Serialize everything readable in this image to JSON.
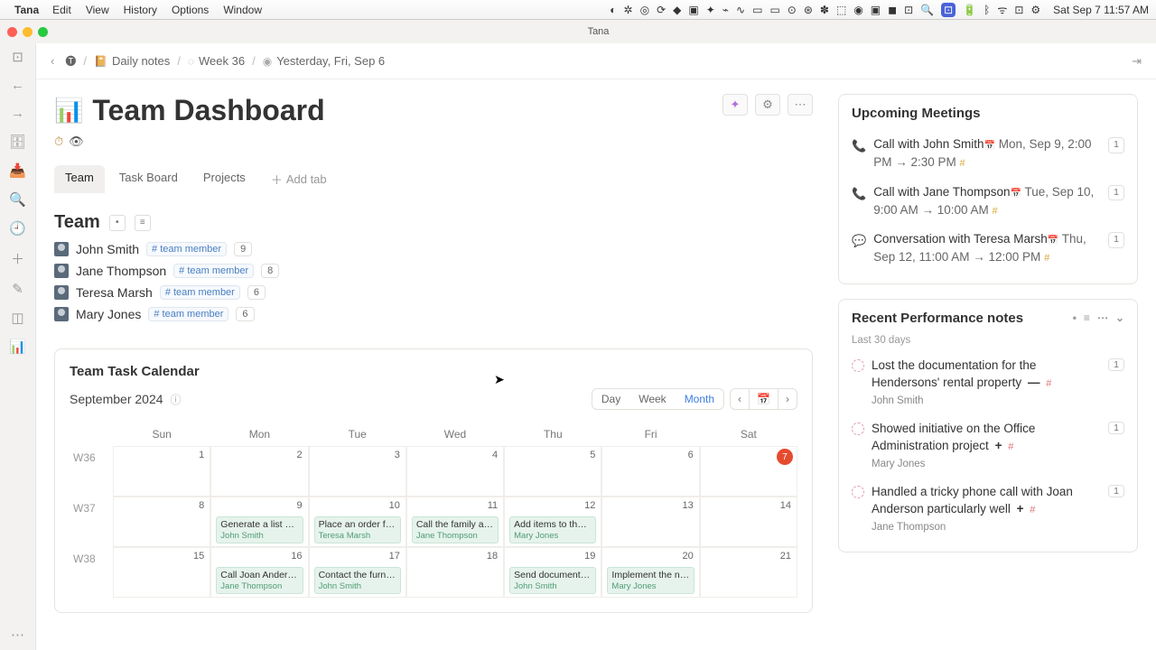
{
  "menubar": {
    "app": "Tana",
    "items": [
      "Edit",
      "View",
      "History",
      "Options",
      "Window"
    ],
    "clock": "Sat Sep 7  11:57 AM"
  },
  "window_title": "Tana",
  "breadcrumbs": {
    "items": [
      "Daily notes",
      "Week 36",
      "Yesterday, Fri, Sep 6"
    ]
  },
  "page": {
    "title": "Team Dashboard",
    "tabs": [
      "Team",
      "Task Board",
      "Projects"
    ],
    "add_tab": "Add tab"
  },
  "team": {
    "heading": "Team",
    "tag_label": "# team member",
    "members": [
      {
        "name": "John Smith",
        "count": "9"
      },
      {
        "name": "Jane Thompson",
        "count": "8"
      },
      {
        "name": "Teresa Marsh",
        "count": "6"
      },
      {
        "name": "Mary Jones",
        "count": "6"
      }
    ]
  },
  "calendar": {
    "title": "Team Task Calendar",
    "month": "September 2024",
    "views": [
      "Day",
      "Week",
      "Month"
    ],
    "active_view": "Month",
    "day_heads": [
      "Sun",
      "Mon",
      "Tue",
      "Wed",
      "Thu",
      "Fri",
      "Sat"
    ],
    "weeks": [
      {
        "wk": "W36",
        "days": [
          "1",
          "2",
          "3",
          "4",
          "5",
          "6",
          "7"
        ],
        "today_index": 6,
        "events": []
      },
      {
        "wk": "W37",
        "days": [
          "8",
          "9",
          "10",
          "11",
          "12",
          "13",
          "14"
        ],
        "events": [
          {
            "day_index": 1,
            "title": "Generate a list of po",
            "who": "John Smith"
          },
          {
            "day_index": 2,
            "title": "Place an order for n",
            "who": "Teresa Marsh"
          },
          {
            "day_index": 3,
            "title": "Call the family attor",
            "who": "Jane Thompson"
          },
          {
            "day_index": 4,
            "title": "Add items to the we",
            "who": "Mary Jones"
          }
        ]
      },
      {
        "wk": "W38",
        "days": [
          "15",
          "16",
          "17",
          "18",
          "19",
          "20",
          "21"
        ],
        "events": [
          {
            "day_index": 1,
            "title": "Call Joan Anderson",
            "who": "Jane Thompson"
          },
          {
            "day_index": 2,
            "title": "Contact the furnitur",
            "who": "John Smith"
          },
          {
            "day_index": 4,
            "title": "Send documents to",
            "who": "John Smith"
          },
          {
            "day_index": 5,
            "title": "Implement the new",
            "who": "Mary Jones"
          }
        ]
      }
    ]
  },
  "meetings": {
    "heading": "Upcoming Meetings",
    "items": [
      {
        "icon": "phone",
        "title": "Call with John Smith",
        "time": "Mon, Sep 9, 2:00 PM → 2:30 PM",
        "count": "1"
      },
      {
        "icon": "phone",
        "title": "Call with Jane Thompson",
        "time": "Tue, Sep 10, 9:00 AM → 10:00 AM",
        "count": "1"
      },
      {
        "icon": "chat",
        "title": "Conversation with Teresa Marsh",
        "time": "Thu, Sep 12, 11:00 AM → 12:00 PM",
        "count": "1"
      }
    ]
  },
  "notes": {
    "heading": "Recent Performance notes",
    "subtitle": "Last 30 days",
    "items": [
      {
        "text": "Lost the documentation for the Hendersons' rental property",
        "sign": "—",
        "who": "John Smith",
        "count": "1"
      },
      {
        "text": "Showed initiative on the Office Administration project",
        "sign": "+",
        "who": "Mary Jones",
        "count": "1"
      },
      {
        "text": "Handled a tricky phone call with Joan Anderson particularly well",
        "sign": "+",
        "who": "Jane Thompson",
        "count": "1"
      }
    ]
  }
}
